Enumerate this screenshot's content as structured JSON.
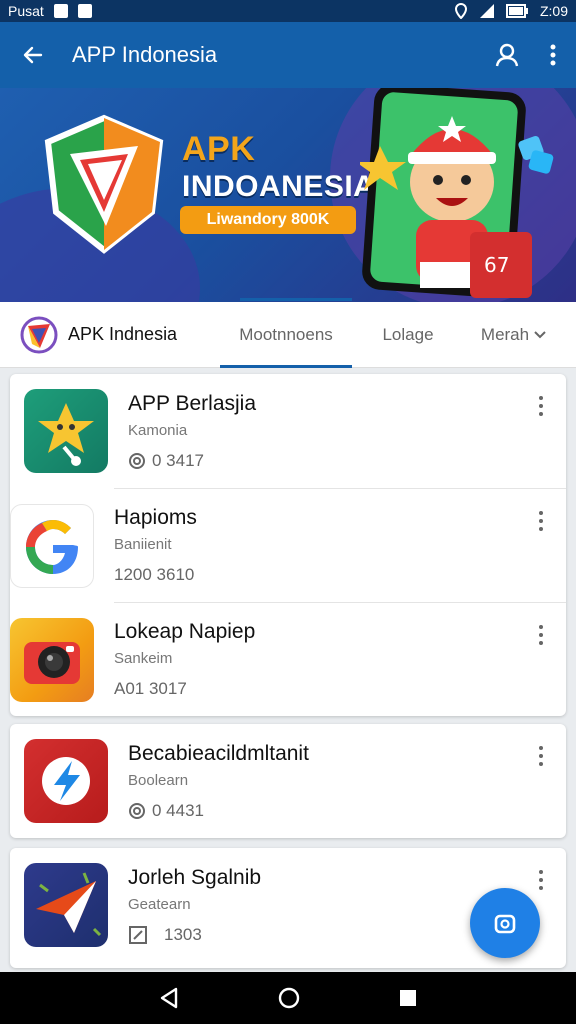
{
  "status_bar": {
    "carrier": "Pusat",
    "time": "Z:09"
  },
  "app_bar": {
    "title": "APP Indonesia"
  },
  "banner": {
    "line1": "APK",
    "line2": "INDOANESIA",
    "pill": "Liwandory 800K"
  },
  "tabs": {
    "brand_label": "APK Indnesia",
    "items": [
      {
        "label": "Mootnnoens",
        "active": true
      },
      {
        "label": "Lolage",
        "active": false
      },
      {
        "label": "Merah",
        "active": false
      }
    ]
  },
  "apps": [
    {
      "name": "APP Berlasjia",
      "category": "Kamonia",
      "meta": "0 3417",
      "icon": "star-character-icon"
    },
    {
      "name": "Hapioms",
      "category": "Baniienit",
      "meta": "1200 3610",
      "icon": "google-g-icon"
    },
    {
      "name": "Lokeap Napiep",
      "category": "Sankeim",
      "meta": "A01 3017",
      "icon": "camera-icon"
    },
    {
      "name": "Becabieacildmltanit",
      "category": "Boolearn",
      "meta": "0 4431",
      "icon": "lightning-icon"
    },
    {
      "name": "Jorleh Sgalnib",
      "category": "Geatearn",
      "meta": "1303",
      "icon": "paper-plane-icon"
    }
  ],
  "colors": {
    "primary": "#1460aa",
    "status": "#0c3463",
    "fab": "#1f80e6",
    "accent": "#f39c12"
  }
}
